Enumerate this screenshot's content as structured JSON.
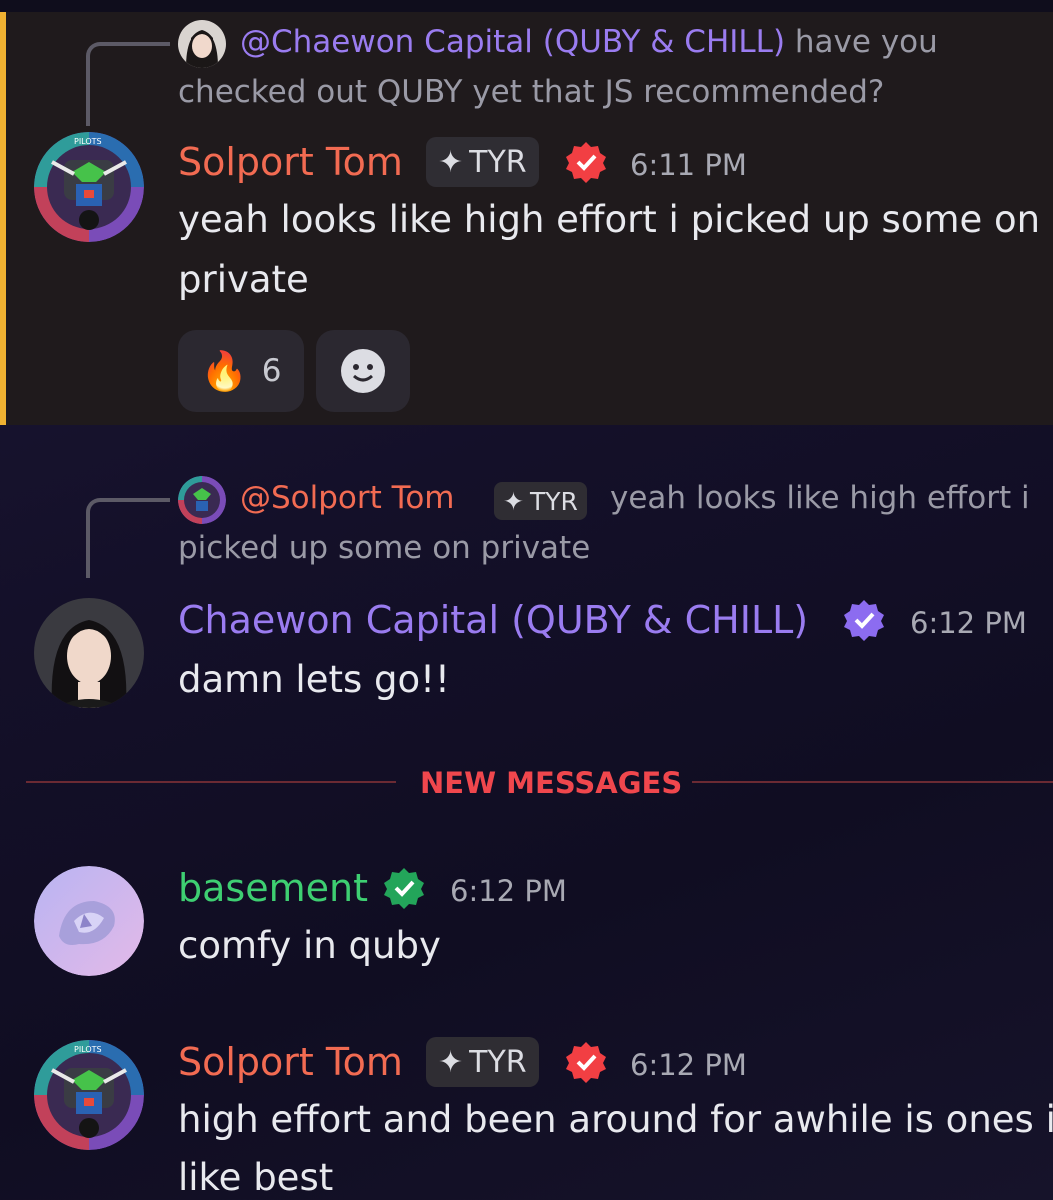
{
  "messages": [
    {
      "reply": {
        "mention": "@Chaewon Capital (QUBY & CHILL)",
        "line1": "have you",
        "line2": "checked out QUBY yet that JS recommended?"
      },
      "author": "Solport Tom",
      "tag": "TYR",
      "time": "6:11 PM",
      "text_line1": "yeah looks like high effort i picked up some on",
      "text_line2": "private",
      "reactions": [
        {
          "emoji": "🔥",
          "count": "6"
        }
      ]
    },
    {
      "reply": {
        "mention": "@Solport Tom",
        "tag": "TYR",
        "line1": "yeah looks like high effort i",
        "line2": "picked up some on private"
      },
      "author": "Chaewon Capital (QUBY & CHILL)",
      "time": "6:12 PM",
      "text_line1": "damn lets go!!"
    },
    {
      "author": "basement",
      "time": "6:12 PM",
      "text_line1": "comfy in quby"
    },
    {
      "author": "Solport Tom",
      "tag": "TYR",
      "time": "6:12 PM",
      "text_line1": "high effort and been around for awhile is ones i",
      "text_line2": "like best"
    }
  ],
  "divider": {
    "label": "NEW MESSAGES"
  },
  "icons": {
    "verified_red": "#f23f43",
    "verified_purple": "#8c6cf0",
    "verified_green": "#23a55a",
    "highlight": "#f0b232"
  }
}
